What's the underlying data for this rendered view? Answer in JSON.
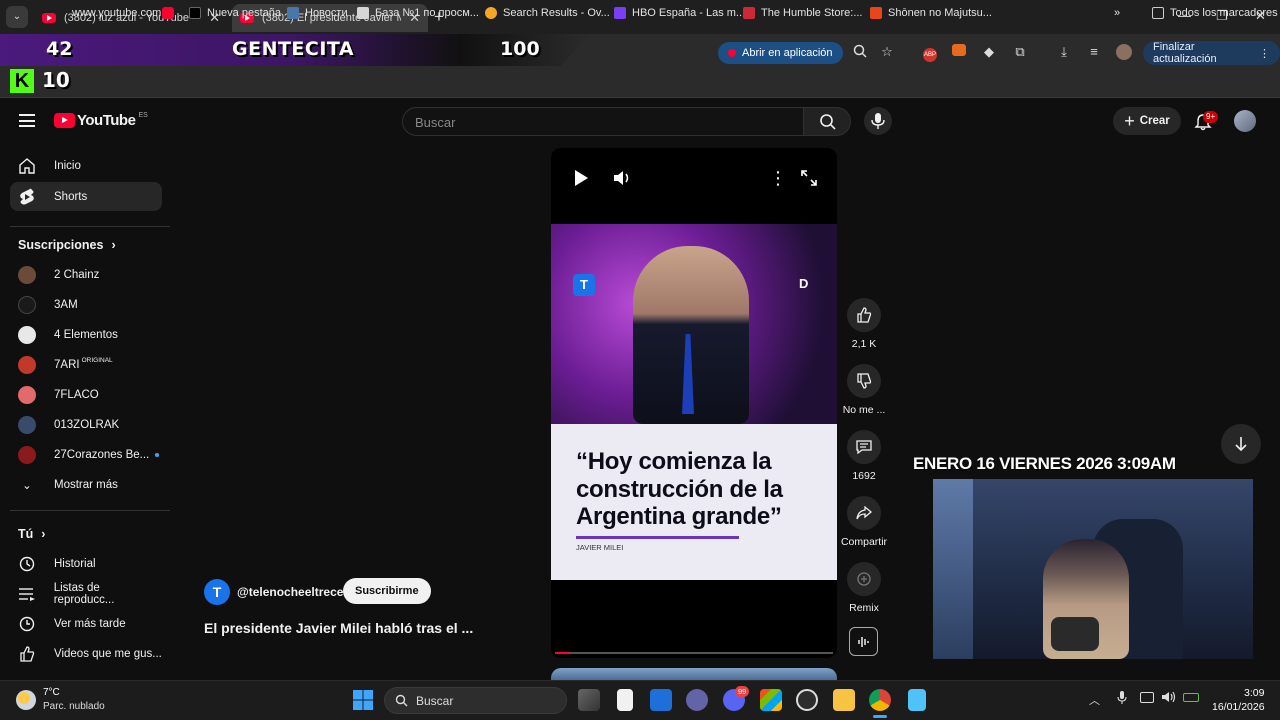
{
  "browser": {
    "tabs": [
      {
        "title": "(3802) luz azul - YouTube",
        "active": false
      },
      {
        "title": "(3802) El presidente Javier Mile",
        "active": true
      }
    ],
    "new_tab": "+",
    "window_controls": {
      "minimize": "—",
      "maximize": "❐",
      "close": "✕"
    }
  },
  "overlay": {
    "left_number": "42",
    "title": "GENTECITA",
    "right_number": "100",
    "badge_letter": "K",
    "badge_number": "10"
  },
  "toolbar": {
    "url_visible": "www.youtube.com",
    "open_in_app": "Abrir en aplicación",
    "update_button": "Finalizar actualización"
  },
  "bookmarks": [
    {
      "label": "Nueva pestaña",
      "color": "#ffffff"
    },
    {
      "label": "Новости",
      "color": "#4a76a8"
    },
    {
      "label": "База №1 по просм...",
      "color": "#d6d6d6"
    },
    {
      "label": "Search Results - Ov...",
      "color": "#f5a623"
    },
    {
      "label": "HBO España - Las m...",
      "color": "#7b3ff2"
    },
    {
      "label": "The Humble Store:...",
      "color": "#cc2936"
    },
    {
      "label": "Shōnen no Majutsu...",
      "color": "#e8451e"
    }
  ],
  "bookmarks_all": "Todos los marcadores",
  "youtube": {
    "logo_text": "YouTube",
    "logo_region": "ES",
    "search_placeholder": "Buscar",
    "create_label": "Crear",
    "notif_badge": "9+"
  },
  "sidebar": {
    "main": [
      {
        "label": "Inicio",
        "icon": "home-icon"
      },
      {
        "label": "Shorts",
        "icon": "shorts-icon"
      }
    ],
    "subs_header": "Suscripciones",
    "subs": [
      {
        "label": "2 Chainz",
        "color": "#6b4a3a"
      },
      {
        "label": "3AM",
        "color": "#1a1a1a"
      },
      {
        "label": "4 Elementos",
        "color": "#e8e8e8"
      },
      {
        "label": "7ARI",
        "sup": "ORIGINAL",
        "color": "#c0392b"
      },
      {
        "label": "7FLACO",
        "color": "#e36a6a"
      },
      {
        "label": "013ZOLRAK",
        "color": "#3a4a6a"
      },
      {
        "label": "27Corazones Be...",
        "color": "#8b1a1a"
      }
    ],
    "show_more": "Mostrar más",
    "you_header": "Tú",
    "you_items": [
      {
        "label": "Historial"
      },
      {
        "label": "Listas de reproducc..."
      },
      {
        "label": "Ver más tarde"
      },
      {
        "label": "Videos que me gus..."
      }
    ]
  },
  "short": {
    "channel_handle": "@telenocheeltrece",
    "subscribe": "Suscribirme",
    "video_title": "El presidente Javier Milei habló tras el ...",
    "quote": "“Hoy comienza la construcción de la Argentina grande”",
    "speaker": "JAVIER MILEI",
    "likes": "2,1 K",
    "dislike_label": "No me ...",
    "comments": "1692",
    "share_label": "Compartir",
    "remix_label": "Remix",
    "progress": 0.05
  },
  "stream": {
    "datetime": "ENERO 16 VIERNES 2026 3:09AM"
  },
  "taskbar": {
    "weather_temp": "7°C",
    "weather_desc": "Parc. nublado",
    "search_placeholder": "Buscar",
    "time": "3:09",
    "date": "16/01/2026",
    "badge": "99"
  }
}
